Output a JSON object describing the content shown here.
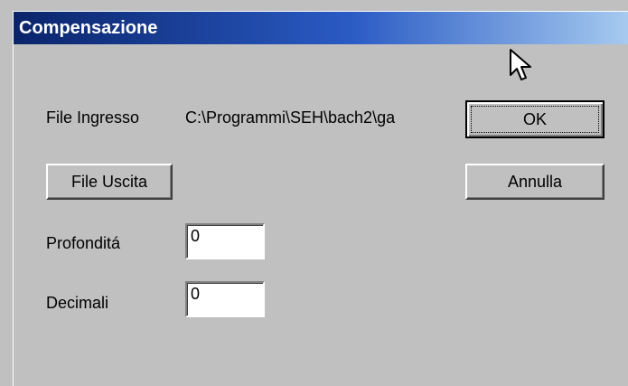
{
  "window": {
    "title": "Compensazione"
  },
  "fields": {
    "input_file_label": "File Ingresso",
    "input_file_path": "C:\\Programmi\\SEH\\bach2\\ga",
    "output_file_button": "File Uscita",
    "depth_label": "Profonditá",
    "depth_value": "0",
    "decimals_label": "Decimali",
    "decimals_value": "0"
  },
  "buttons": {
    "ok": "OK",
    "cancel": "Annulla"
  },
  "icons": {
    "cursor": "mouse-pointer-icon"
  },
  "colors": {
    "title_start": "#0a246a",
    "title_end": "#a6caf0",
    "face": "#c0c0c0"
  }
}
